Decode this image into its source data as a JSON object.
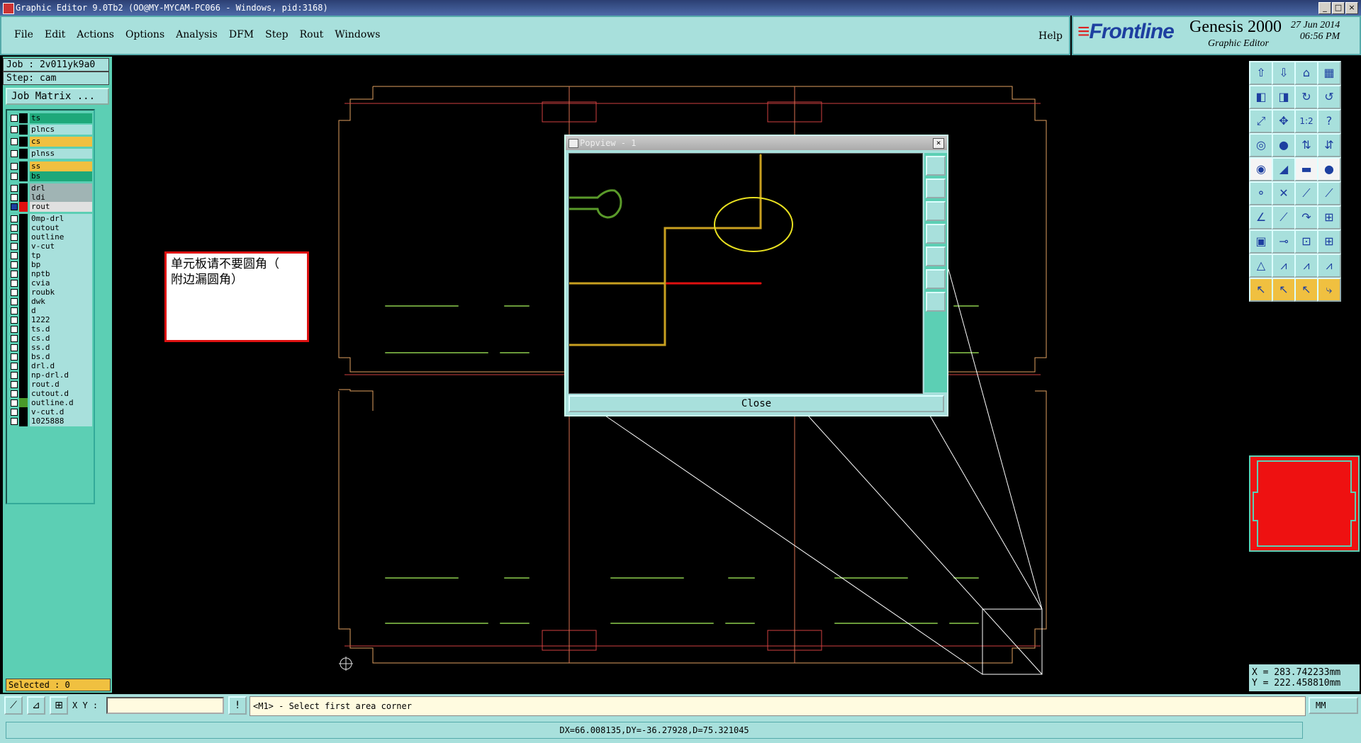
{
  "window": {
    "title": "Graphic Editor 9.0Tb2 (OO@MY-MYCAM-PC066 - Windows, pid:3168)",
    "min": "_",
    "max": "□",
    "close": "×"
  },
  "menu": [
    "File",
    "Edit",
    "Actions",
    "Options",
    "Analysis",
    "DFM",
    "Step",
    "Rout",
    "Windows"
  ],
  "help": "Help",
  "brand": {
    "company": "Frontline",
    "product": "Genesis 2000",
    "subtitle": "Graphic Editor",
    "date": "27 Jun 2014",
    "time": "06:56 PM"
  },
  "job": {
    "job_label": "Job : 2v011yk9a0",
    "step_label": "Step: cam",
    "matrix_button": "Job Matrix ..."
  },
  "layers": [
    {
      "name": "ts",
      "color": "#1ea87a"
    },
    {
      "name": "plncs",
      "color": "#a8e0dc"
    },
    {
      "name": "cs",
      "color": "#f0c040"
    },
    {
      "name": "plnss",
      "color": "#a8e0dc"
    },
    {
      "name": "ss",
      "color": "#f0c040"
    },
    {
      "name": "bs",
      "color": "#1ea87a"
    },
    {
      "name": "drl",
      "color": "#a0b4b4"
    },
    {
      "name": "ldi",
      "color": "#a0b4b4"
    },
    {
      "name": "rout",
      "color": "#e0e0e0",
      "active": true
    },
    {
      "name": "0mp-drl",
      "color": "#a8e0dc"
    },
    {
      "name": "cutout",
      "color": "#a8e0dc"
    },
    {
      "name": "outline",
      "color": "#a8e0dc"
    },
    {
      "name": "v-cut",
      "color": "#a8e0dc"
    },
    {
      "name": "tp",
      "color": "#a8e0dc"
    },
    {
      "name": "bp",
      "color": "#a8e0dc"
    },
    {
      "name": "nptb",
      "color": "#a8e0dc"
    },
    {
      "name": "cvia",
      "color": "#a8e0dc"
    },
    {
      "name": "roubk",
      "color": "#a8e0dc"
    },
    {
      "name": "dwk",
      "color": "#a8e0dc"
    },
    {
      "name": "d",
      "color": "#a8e0dc"
    },
    {
      "name": "1222",
      "color": "#a8e0dc"
    },
    {
      "name": "ts.d",
      "color": "#a8e0dc"
    },
    {
      "name": "cs.d",
      "color": "#a8e0dc"
    },
    {
      "name": "ss.d",
      "color": "#a8e0dc"
    },
    {
      "name": "bs.d",
      "color": "#a8e0dc"
    },
    {
      "name": "drl.d",
      "color": "#a8e0dc"
    },
    {
      "name": "np-drl.d",
      "color": "#a8e0dc"
    },
    {
      "name": "rout.d",
      "color": "#a8e0dc"
    },
    {
      "name": "cutout.d",
      "color": "#a8e0dc"
    },
    {
      "name": "outline.d",
      "color": "#a8e0dc"
    },
    {
      "name": "v-cut.d",
      "color": "#a8e0dc"
    },
    {
      "name": "1025888",
      "color": "#a8e0dc"
    }
  ],
  "selected": "Selected : 0",
  "note": {
    "line1": "单元板请不要圆角（",
    "line2": "附边漏圆角）"
  },
  "popview": {
    "title": "Popview - 1",
    "close_button": "Close",
    "close_x": "×"
  },
  "coords": {
    "x": "X = 283.742233mm",
    "y": "Y = 222.458810mm"
  },
  "bottom": {
    "xy_label": "X Y :",
    "xy_value": "",
    "prompt": "<M1> - Select first area corner",
    "units": "MM",
    "status": "DX=66.008135,DY=-36.27928,D=75.321045"
  },
  "tools": {
    "row1": [
      "⇧",
      "⇩",
      "⌂",
      "▦"
    ],
    "row2": [
      "◧",
      "◨",
      "↻",
      "↺"
    ],
    "row3": [
      "⤢",
      "✥",
      "1:2",
      "?"
    ],
    "row4": [
      "◎",
      "●",
      "⇅",
      "⇵"
    ],
    "row5": [
      "◉",
      "◢",
      "▬",
      "●"
    ],
    "row6": [
      "⚬",
      "✕",
      "⟋",
      "⟋"
    ],
    "row7": [
      "∠",
      "⟋",
      "↷",
      "⊞"
    ],
    "row8": [
      "▣",
      "⊸",
      "⊡",
      "⊞"
    ],
    "row9": [
      "△",
      "⩘",
      "⩘",
      "⩘"
    ],
    "row10": [
      "↖",
      "↖",
      "↖",
      "⤷"
    ]
  }
}
